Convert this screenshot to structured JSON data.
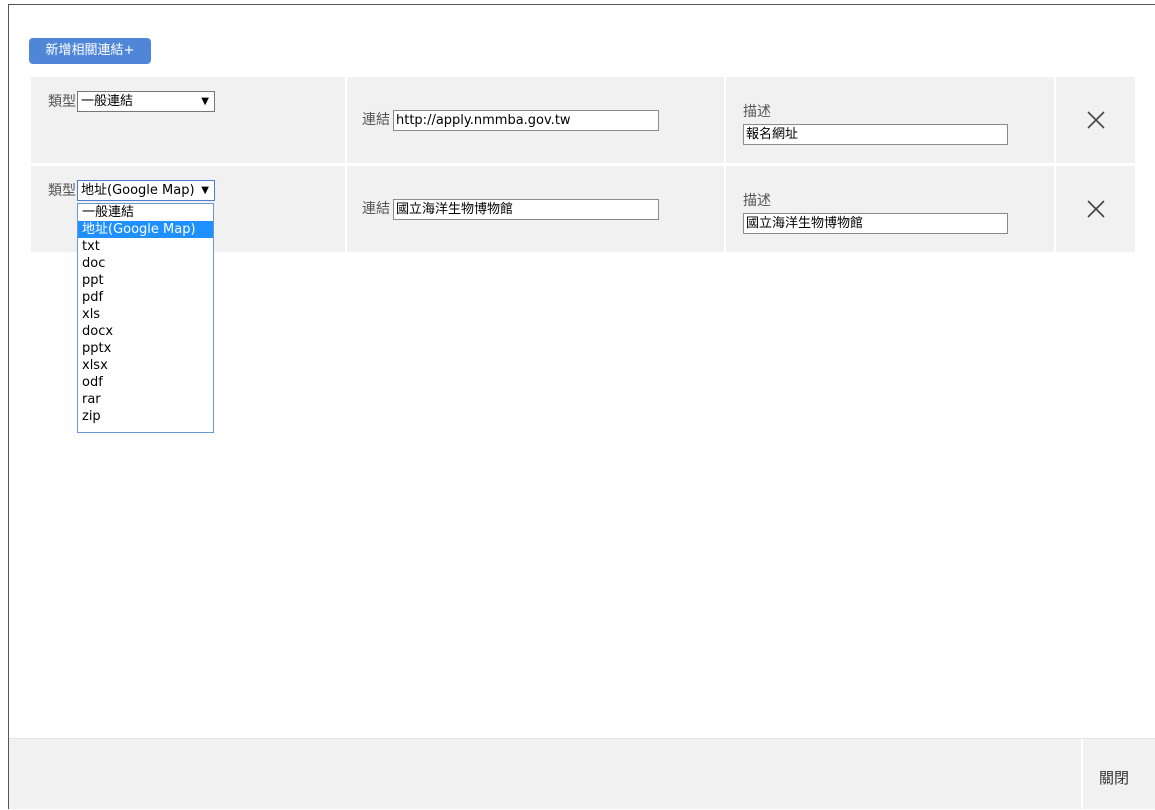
{
  "toolbar": {
    "add_label": "新增相關連結+"
  },
  "labels": {
    "type": "類型",
    "link": "連結",
    "desc": "描述"
  },
  "rows": [
    {
      "type_value": "一般連結",
      "link_value": "http://apply.nmmba.gov.tw",
      "desc_value": "報名網址"
    },
    {
      "type_value": "地址(Google Map)",
      "link_value": "國立海洋生物博物館",
      "desc_value": "國立海洋生物博物館"
    }
  ],
  "dropdown": {
    "options": [
      "一般連結",
      "地址(Google Map)",
      "txt",
      "doc",
      "ppt",
      "pdf",
      "xls",
      "docx",
      "pptx",
      "xlsx",
      "odf",
      "rar",
      "zip"
    ],
    "selected_index": 1
  },
  "footer": {
    "close_label": "關閉"
  },
  "colors": {
    "accent": "#4f86d8",
    "highlight": "#1e90ff",
    "row_bg": "#f1f1f1"
  },
  "icons": {
    "delete": "close-icon",
    "select_arrow": "caret-down-icon"
  }
}
